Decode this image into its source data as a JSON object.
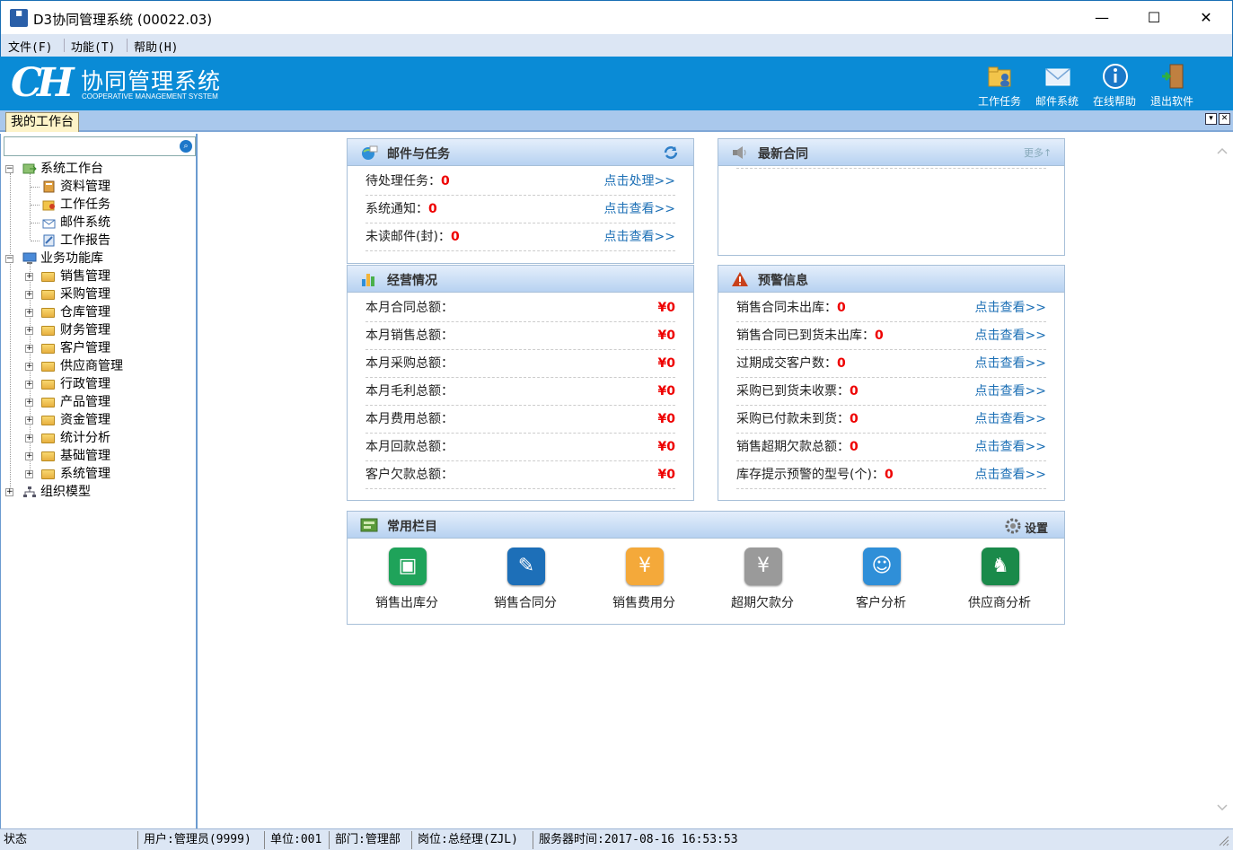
{
  "window": {
    "title": "D3协同管理系统 (00022.03)",
    "minimize": "—",
    "maximize": "☐",
    "close": "✕"
  },
  "menu": [
    {
      "label": "文件(F)"
    },
    {
      "label": "功能(T)"
    },
    {
      "label": "帮助(H)"
    }
  ],
  "banner": {
    "logo_mark": "CH",
    "title": "协同管理系统",
    "subtitle": "COOPERATIVE MANAGEMENT SYSTEM",
    "buttons": [
      {
        "label": "工作任务",
        "icon": "folder-user-icon"
      },
      {
        "label": "邮件系统",
        "icon": "mail-icon"
      },
      {
        "label": "在线帮助",
        "icon": "info-icon"
      },
      {
        "label": "退出软件",
        "icon": "exit-door-icon"
      }
    ]
  },
  "tabs": {
    "active": "我的工作台",
    "dropdown": "▾",
    "close": "✕"
  },
  "sidebar": {
    "search_placeholder": "",
    "tree": {
      "root1": {
        "label": "系统工作台",
        "expand": "−",
        "children": [
          {
            "label": "资料管理"
          },
          {
            "label": "工作任务"
          },
          {
            "label": "邮件系统"
          },
          {
            "label": "工作报告"
          }
        ]
      },
      "root2": {
        "label": "业务功能库",
        "expand": "−",
        "children": [
          {
            "label": "销售管理"
          },
          {
            "label": "采购管理"
          },
          {
            "label": "仓库管理"
          },
          {
            "label": "财务管理"
          },
          {
            "label": "客户管理"
          },
          {
            "label": "供应商管理"
          },
          {
            "label": "行政管理"
          },
          {
            "label": "产品管理"
          },
          {
            "label": "资金管理"
          },
          {
            "label": "统计分析"
          },
          {
            "label": "基础管理"
          },
          {
            "label": "系统管理"
          }
        ]
      },
      "root3": {
        "label": "组织模型",
        "expand": "+"
      }
    }
  },
  "mail_tasks": {
    "title": "邮件与任务",
    "rows": [
      {
        "label": "待处理任务：",
        "value": "0",
        "link": "点击处理>>"
      },
      {
        "label": "系统通知：",
        "value": "0",
        "link": "点击查看>>"
      },
      {
        "label": "未读邮件(封)：",
        "value": "0",
        "link": "点击查看>>"
      }
    ]
  },
  "latest_contracts": {
    "title": "最新合同",
    "more": "更多↑"
  },
  "business": {
    "title": "经营情况",
    "rows": [
      {
        "label": "本月合同总额：",
        "value": "¥0"
      },
      {
        "label": "本月销售总额：",
        "value": "¥0"
      },
      {
        "label": "本月采购总额：",
        "value": "¥0"
      },
      {
        "label": "本月毛利总额：",
        "value": "¥0"
      },
      {
        "label": "本月费用总额：",
        "value": "¥0"
      },
      {
        "label": "本月回款总额：",
        "value": "¥0"
      },
      {
        "label": "客户欠款总额：",
        "value": "¥0"
      }
    ]
  },
  "alerts": {
    "title": "预警信息",
    "rows": [
      {
        "label": "销售合同未出库：",
        "value": "0",
        "link": "点击查看>>"
      },
      {
        "label": "销售合同已到货未出库：",
        "value": "0",
        "link": "点击查看>>"
      },
      {
        "label": "过期成交客户数：",
        "value": "0",
        "link": "点击查看>>"
      },
      {
        "label": "采购已到货未收票：",
        "value": "0",
        "link": "点击查看>>"
      },
      {
        "label": "采购已付款未到货：",
        "value": "0",
        "link": "点击查看>>"
      },
      {
        "label": "销售超期欠款总额：",
        "value": "0",
        "link": "点击查看>>"
      },
      {
        "label": "库存提示预警的型号(个)：",
        "value": "0",
        "link": "点击查看>>"
      }
    ]
  },
  "quick": {
    "title": "常用栏目",
    "settings": "设置",
    "items": [
      {
        "label": "销售出库分析",
        "color": "#1fa35a",
        "icon": "bus-icon"
      },
      {
        "label": "销售合同分析",
        "color": "#1d6fb8",
        "icon": "contract-icon"
      },
      {
        "label": "销售费用分析",
        "color": "#f4a93a",
        "icon": "money-bag-icon"
      },
      {
        "label": "超期欠款分析",
        "color": "#9a9a9a",
        "icon": "yen-minus-icon"
      },
      {
        "label": "客户分析",
        "color": "#2f8fd8",
        "icon": "customer-icon"
      },
      {
        "label": "供应商分析",
        "color": "#1a8a4a",
        "icon": "supplier-icon"
      }
    ]
  },
  "status": {
    "state": "状态",
    "user": "用户:管理员(9999)",
    "unit": "单位:001",
    "dept": "部门:管理部",
    "post": "岗位:总经理(ZJL)",
    "server_time": "服务器时间:2017-08-16 16:53:53"
  },
  "colors": {
    "banner": "#0a8bd6",
    "accent_red": "#e00000",
    "link": "#1c6fb5"
  }
}
